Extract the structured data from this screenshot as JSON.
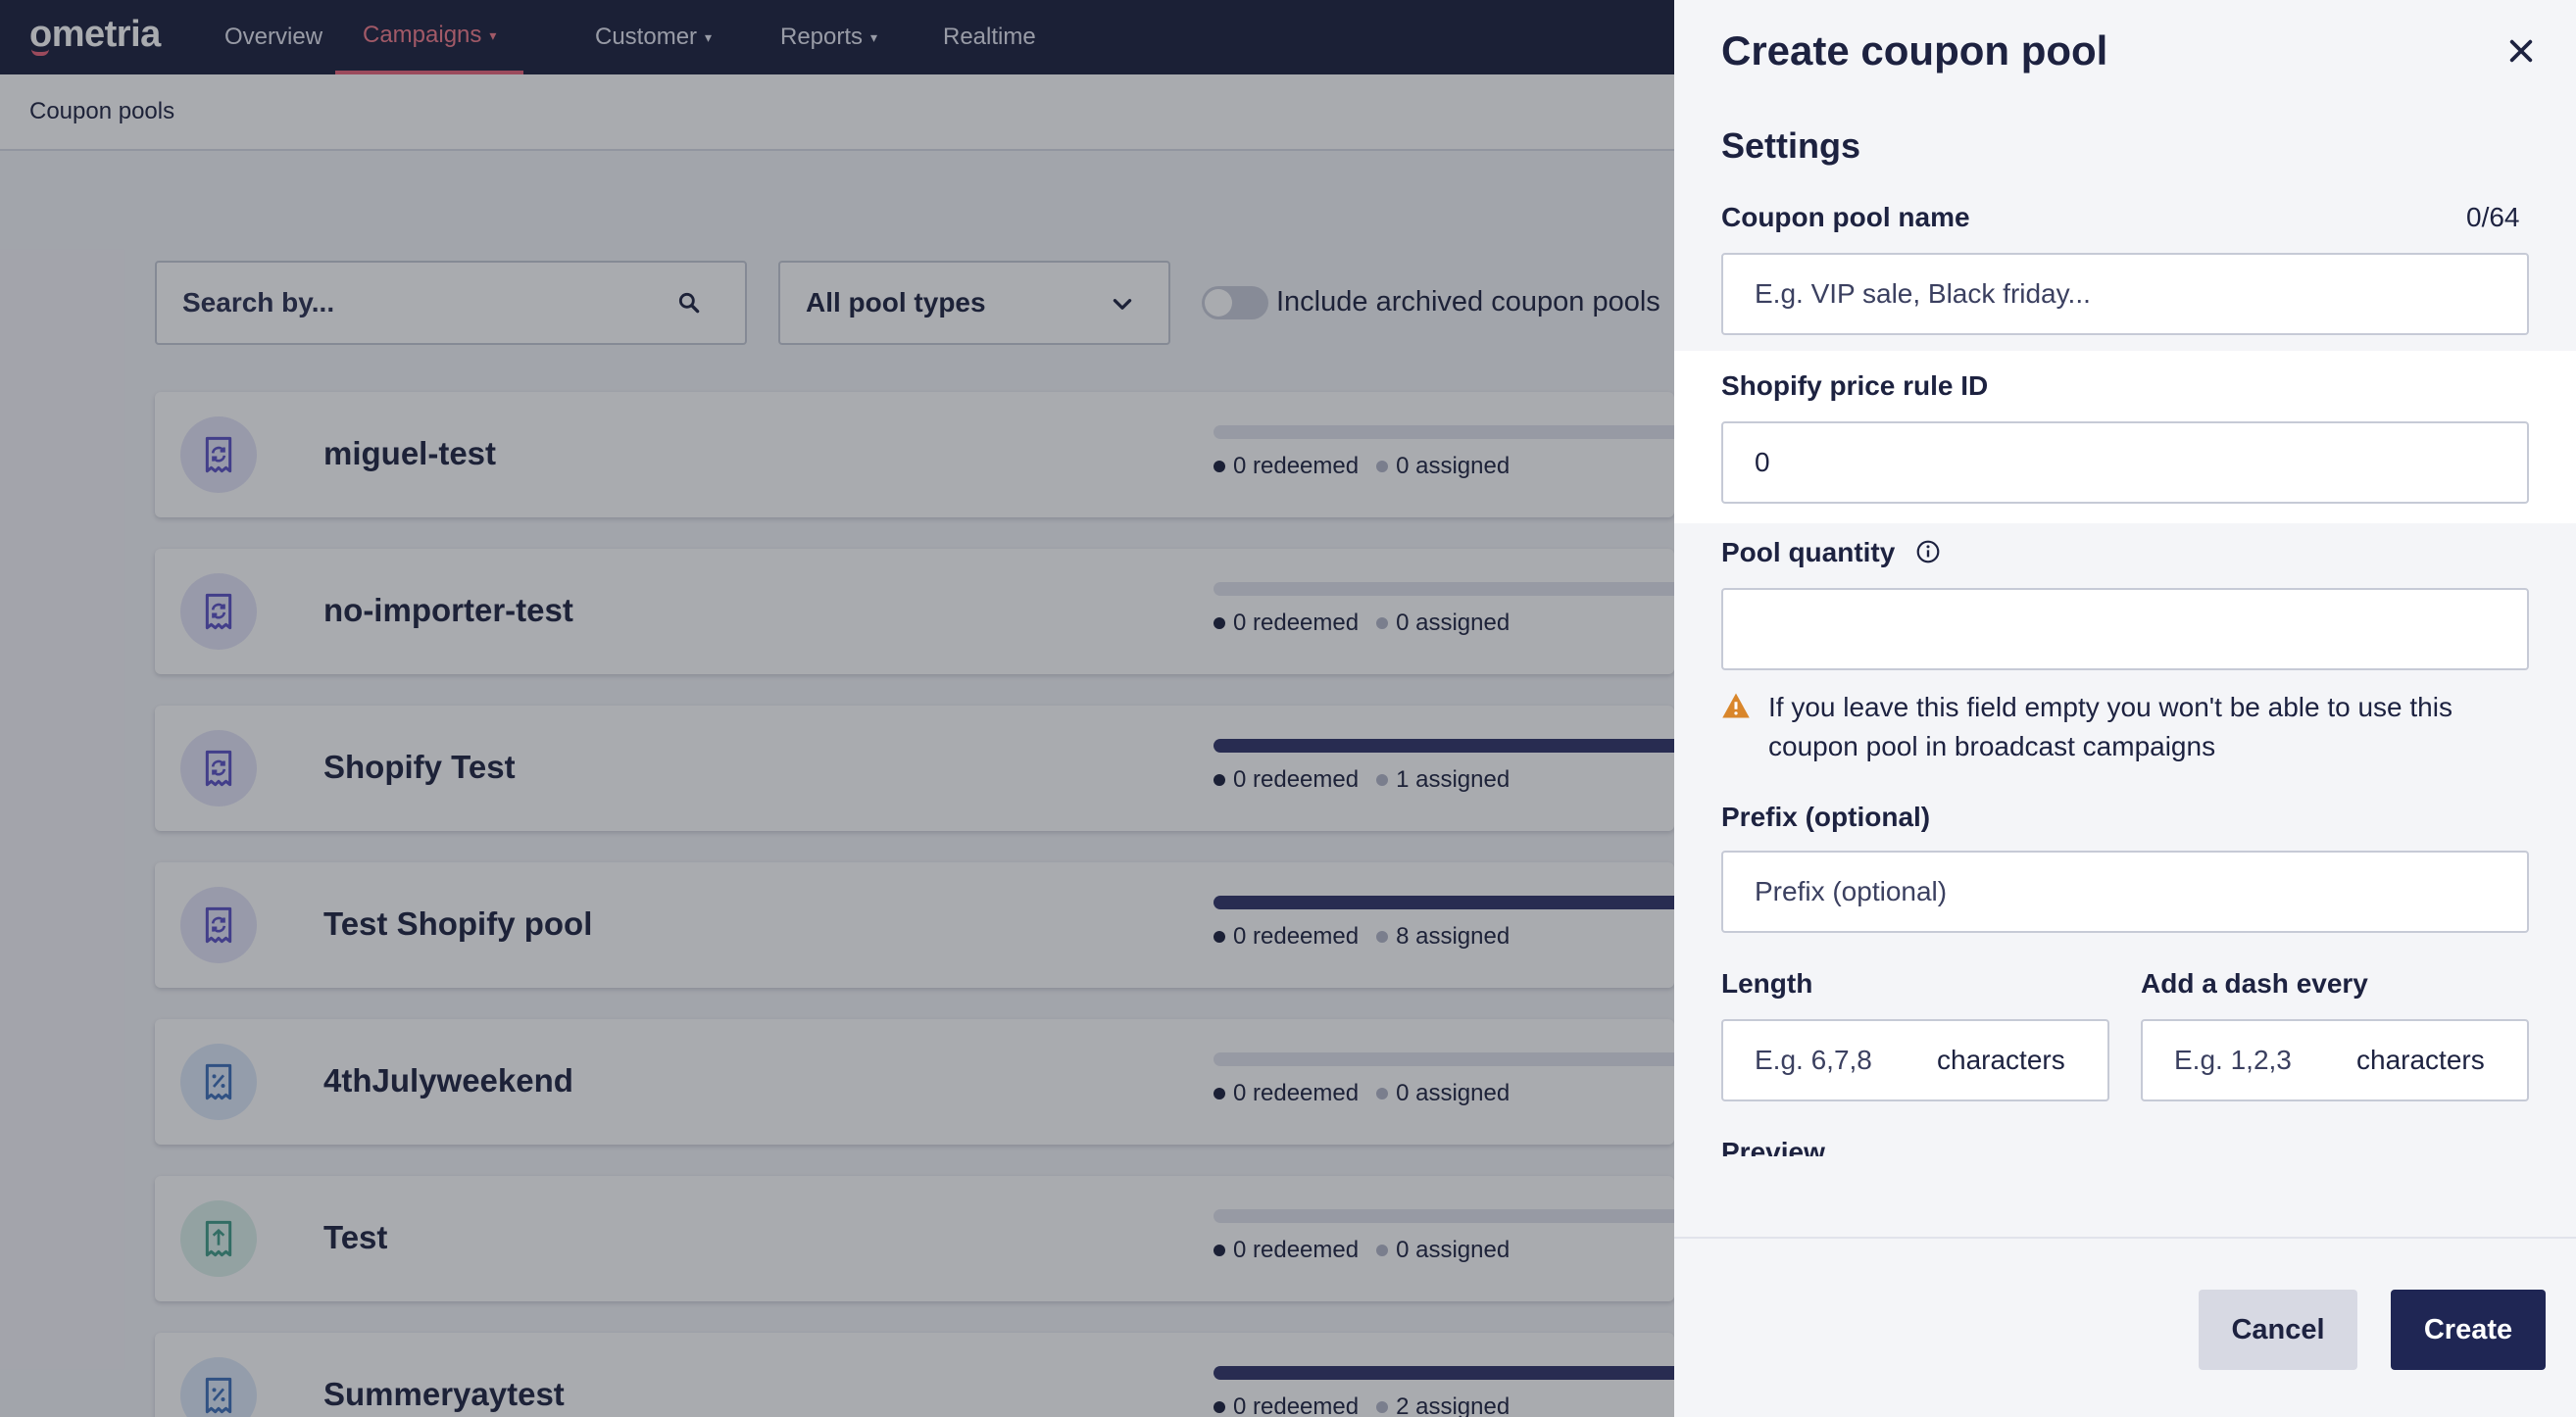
{
  "app": {
    "logo": "ometria",
    "nav": [
      {
        "label": "Overview",
        "has_caret": false
      },
      {
        "label": "Campaigns",
        "has_caret": true,
        "active": true
      },
      {
        "label": "Customer",
        "has_caret": true
      },
      {
        "label": "Reports",
        "has_caret": true
      },
      {
        "label": "Realtime",
        "has_caret": false
      }
    ],
    "accent_color": "#e8637a",
    "nav_bg": "#1b1f3c"
  },
  "page": {
    "breadcrumb": "Coupon pools"
  },
  "filters": {
    "search_placeholder": "Search by...",
    "search_icon": "search-icon",
    "pool_type_selected": "All pool types",
    "archived_toggle_label": "Include archived coupon pools",
    "archived_toggle_on": false
  },
  "pools": [
    {
      "name": "miguel-test",
      "icon": "refresh-receipt-icon",
      "redeemed": "0 redeemed",
      "assigned": "0 assigned",
      "assigned_fraction": 0
    },
    {
      "name": "no-importer-test",
      "icon": "refresh-receipt-icon",
      "redeemed": "0 redeemed",
      "assigned": "0 assigned",
      "assigned_fraction": 0
    },
    {
      "name": "Shopify Test",
      "icon": "refresh-receipt-icon",
      "redeemed": "0 redeemed",
      "assigned": "1 assigned",
      "assigned_fraction": 1
    },
    {
      "name": "Test Shopify pool",
      "icon": "refresh-receipt-icon",
      "redeemed": "0 redeemed",
      "assigned": "8 assigned",
      "assigned_fraction": 1
    },
    {
      "name": "4thJulyweekend",
      "icon": "percent-receipt-icon",
      "redeemed": "0 redeemed",
      "assigned": "0 assigned",
      "assigned_fraction": 0
    },
    {
      "name": "Test",
      "icon": "upload-receipt-icon",
      "redeemed": "0 redeemed",
      "assigned": "0 assigned",
      "assigned_fraction": 0
    },
    {
      "name": "Summeryaytest",
      "icon": "percent-receipt-icon",
      "redeemed": "0 redeemed",
      "assigned": "2 assigned",
      "assigned_fraction": 1
    }
  ],
  "panel": {
    "title": "Create coupon pool",
    "close_icon": "close-icon",
    "section_title": "Settings",
    "pool_name": {
      "label": "Coupon pool name",
      "counter": "0/64",
      "placeholder": "E.g. VIP sale, Black friday...",
      "value": ""
    },
    "shopify_rule": {
      "label": "Shopify price rule ID",
      "value": "0"
    },
    "pool_quantity": {
      "label": "Pool quantity",
      "info_icon": "info-icon",
      "value": ""
    },
    "warning": {
      "icon": "warning-icon",
      "text": "If you leave this field empty you won't be able to use this coupon pool in broadcast campaigns"
    },
    "prefix": {
      "label": "Prefix (optional)",
      "placeholder": "Prefix (optional)"
    },
    "length": {
      "label": "Length",
      "placeholder": "E.g. 6,7,8",
      "suffix": "characters"
    },
    "dash": {
      "label": "Add a dash every",
      "placeholder": "E.g. 1,2,3",
      "suffix": "characters"
    },
    "preview_label": "Preview",
    "cancel_label": "Cancel",
    "create_label": "Create"
  }
}
